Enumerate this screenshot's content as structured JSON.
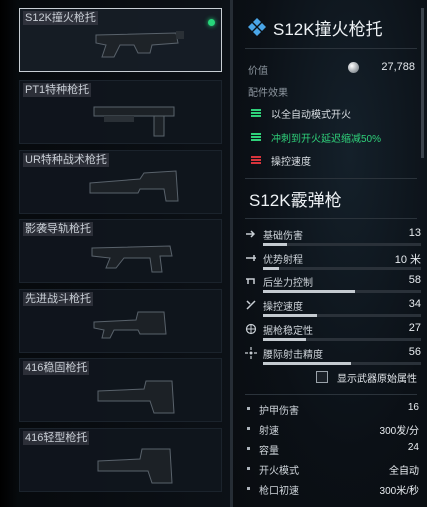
{
  "attachment_list": {
    "items": [
      {
        "label": "S12K撞火枪托",
        "selected": true,
        "equipped": true
      },
      {
        "label": "PT1特种枪托",
        "selected": false,
        "equipped": false
      },
      {
        "label": "UR特种战术枪托",
        "selected": false,
        "equipped": false
      },
      {
        "label": "影袭导轨枪托",
        "selected": false,
        "equipped": false
      },
      {
        "label": "先进战斗枪托",
        "selected": false,
        "equipped": false
      },
      {
        "label": "416稳固枪托",
        "selected": false,
        "equipped": false
      },
      {
        "label": "416轻型枪托",
        "selected": false,
        "equipped": false
      }
    ]
  },
  "detail": {
    "title": "S12K撞火枪托",
    "value_label": "价值",
    "value": "27,788",
    "perks_label": "配件效果",
    "perks": [
      {
        "text": "以全自动模式开火",
        "type": "positive"
      },
      {
        "text": "冲刺到开火延迟缩减50%",
        "type": "positive"
      },
      {
        "text": "操控速度",
        "type": "negative"
      }
    ],
    "weapon_name": "S12K霰弹枪",
    "stats": [
      {
        "label": "基础伤害",
        "value": "13",
        "icon": "damage-icon",
        "level": 0.15
      },
      {
        "label": "优势射程",
        "value": "10 米",
        "icon": "range-icon",
        "level": 0.1
      },
      {
        "label": "后坐力控制",
        "value": "58",
        "icon": "recoil-icon",
        "level": 0.58
      },
      {
        "label": "操控速度",
        "value": "34",
        "icon": "handling-icon",
        "level": 0.34
      },
      {
        "label": "据枪稳定性",
        "value": "27",
        "icon": "stability-icon",
        "level": 0.27
      },
      {
        "label": "腰际射击精度",
        "value": "56",
        "icon": "hipfire-icon",
        "level": 0.56
      }
    ],
    "show_original_label": "显示武器原始属性",
    "attributes": [
      {
        "label": "护甲伤害",
        "value": "16"
      },
      {
        "label": "射速",
        "value": "300发/分"
      },
      {
        "label": "容量",
        "value": "24"
      },
      {
        "label": "开火模式",
        "value": "全自动"
      },
      {
        "label": "枪口初速",
        "value": "300米/秒"
      }
    ]
  },
  "colors": {
    "positive": "#2fd17a",
    "negative": "#d6343c",
    "accent_diamond": "#4aa6e8",
    "equipped_dot": "#27d67b"
  }
}
